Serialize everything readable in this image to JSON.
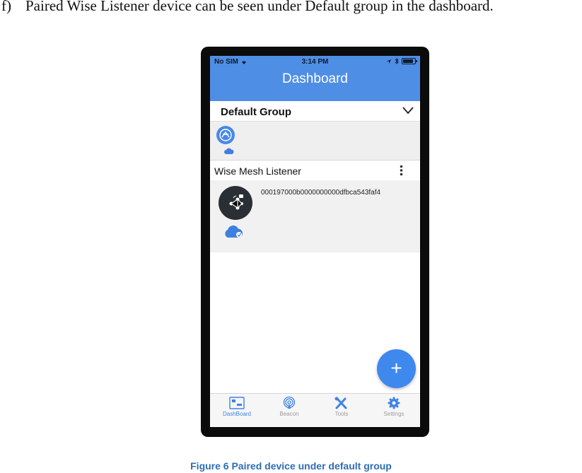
{
  "document": {
    "step_marker": "f)",
    "step_text": "Paired Wise Listener device can be seen under Default group in the dashboard.",
    "caption": "Figure 6 Paired device under default group"
  },
  "phone": {
    "status_bar": {
      "carrier": "No SIM",
      "time": "3:14 PM"
    },
    "header": {
      "title": "Dashboard"
    },
    "group": {
      "name": "Default Group"
    },
    "device_section": {
      "title": "Wise Mesh Listener"
    },
    "device": {
      "id": "000197000b0000000000dfbca543faf4"
    },
    "fab_label": "+",
    "tabs": [
      {
        "label": "DashBoard",
        "icon": "dashboard-icon",
        "active": true
      },
      {
        "label": "Beacon",
        "icon": "beacon-icon",
        "active": false
      },
      {
        "label": "Tools",
        "icon": "tools-icon",
        "active": false
      },
      {
        "label": "Settings",
        "icon": "settings-icon",
        "active": false
      }
    ]
  },
  "colors": {
    "header_blue": "#4f8ee5",
    "fab_blue": "#3f88ee",
    "caption_blue": "#2e6db5"
  }
}
